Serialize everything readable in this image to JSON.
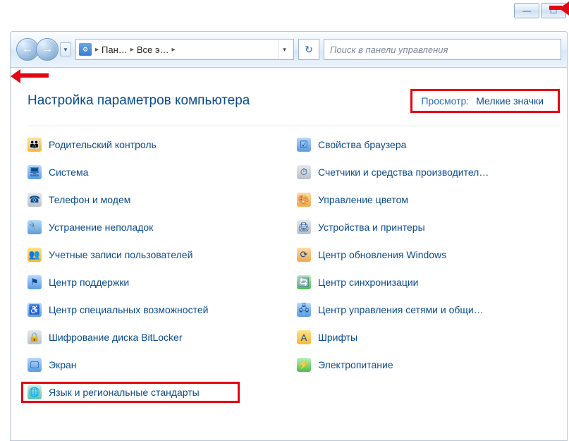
{
  "titlebar": {
    "minimize": "—",
    "maximize": "☐"
  },
  "nav": {
    "back": "←",
    "forward": "→",
    "dropdown": "▼",
    "address_segments": [
      "Пан…",
      "Все э…"
    ],
    "refresh": "↻"
  },
  "search": {
    "placeholder": "Поиск в панели управления"
  },
  "header": {
    "title": "Настройка параметров компьютера",
    "view_label": "Просмотр:",
    "view_value": "Мелкие значки"
  },
  "items_left": [
    "Родительский контроль",
    "Система",
    "Телефон и модем",
    "Устранение неполадок",
    "Учетные записи пользователей",
    "Центр поддержки",
    "Центр специальных возможностей",
    "Шифрование диска BitLocker",
    "Экран",
    "Язык и региональные стандарты"
  ],
  "items_right": [
    "Свойства браузера",
    "Счетчики и средства производител…",
    "Управление цветом",
    "Устройства и принтеры",
    "Центр обновления Windows",
    "Центр синхронизации",
    "Центр управления сетями и общи…",
    "Шрифты",
    "Электропитание"
  ]
}
